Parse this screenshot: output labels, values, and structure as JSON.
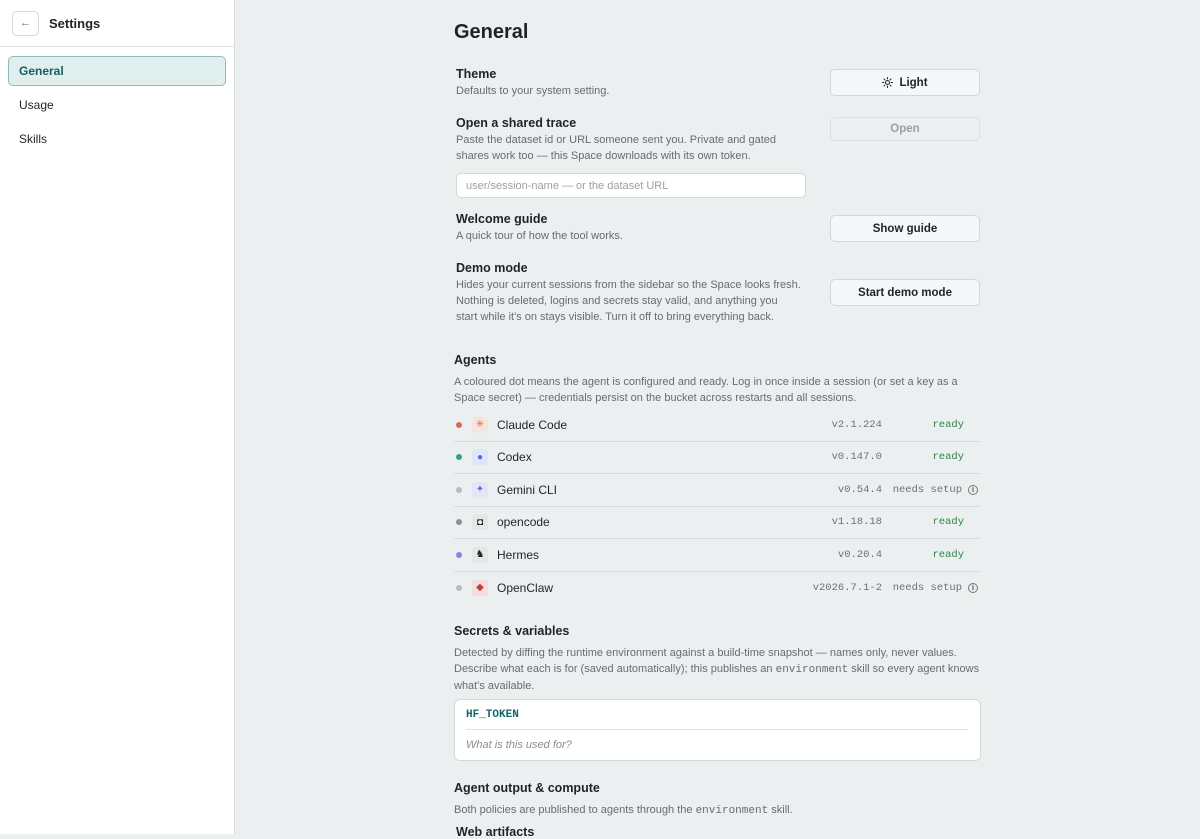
{
  "sidebar": {
    "back_glyph": "←",
    "title": "Settings",
    "items": [
      {
        "label": "General",
        "active": true
      },
      {
        "label": "Usage"
      },
      {
        "label": "Skills"
      }
    ]
  },
  "main": {
    "title": "General",
    "theme": {
      "title": "Theme",
      "desc": "Defaults to your system setting.",
      "button": "Light",
      "icon": "sun-icon"
    },
    "shared_trace": {
      "title": "Open a shared trace",
      "desc": "Paste the dataset id or URL someone sent you. Private and gated shares work too — this Space downloads with its own token.",
      "button": "Open",
      "placeholder": "user/session-name — or the dataset URL"
    },
    "welcome": {
      "title": "Welcome guide",
      "desc": "A quick tour of how the tool works.",
      "button": "Show guide"
    },
    "demo": {
      "title": "Demo mode",
      "desc": "Hides your current sessions from the sidebar so the Space looks fresh. Nothing is deleted, logins and secrets stay valid, and anything you start while it's on stays visible. Turn it off to bring everything back.",
      "button": "Start demo mode"
    },
    "agents": {
      "title": "Agents",
      "desc": "A coloured dot means the agent is configured and ready. Log in once inside a session (or set a key as a Space secret) — credentials persist on the bucket across restarts and all sessions.",
      "list": [
        {
          "name": "Claude Code",
          "version": "v2.1.224",
          "status": "ready",
          "dot": "#d9694a",
          "icon_bg": "#f7e4dc",
          "icon_color": "#d9694a",
          "glyph": "✳"
        },
        {
          "name": "Codex",
          "version": "v0.147.0",
          "status": "ready",
          "dot": "#3a9e8f",
          "icon_bg": "#dfe6fb",
          "icon_color": "#4d6fe0",
          "glyph": "●"
        },
        {
          "name": "Gemini CLI",
          "version": "v0.54.4",
          "status": "needs setup",
          "dot": "#b7bbbf",
          "icon_bg": "#e3e6f7",
          "icon_color": "#6a6fd6",
          "glyph": "✦"
        },
        {
          "name": "opencode",
          "version": "v1.18.18",
          "status": "ready",
          "dot": "#8a8f94",
          "icon_bg": "#e4e6e8",
          "icon_color": "#111111",
          "glyph": "◘"
        },
        {
          "name": "Hermes",
          "version": "v0.20.4",
          "status": "ready",
          "dot": "#9a7be0",
          "icon_bg": "#e5e6e8",
          "icon_color": "#222222",
          "glyph": "♞"
        },
        {
          "name": "OpenClaw",
          "version": "v2026.7.1-2",
          "status": "needs setup",
          "dot": "#b7bbbf",
          "icon_bg": "#f5dede",
          "icon_color": "#c93a3a",
          "glyph": "◆"
        }
      ]
    },
    "secrets": {
      "title": "Secrets & variables",
      "desc_pre": "Detected by diffing the runtime environment against a build-time snapshot — names only, never values. Describe what each is for (saved automatically); this publishes an ",
      "desc_code": "environment",
      "desc_post": " skill so every agent knows what's available.",
      "name": "HF_TOKEN",
      "placeholder": "What is this used for?"
    },
    "compute": {
      "title": "Agent output & compute",
      "desc_pre": "Both policies are published to agents through the ",
      "desc_code": "environment",
      "desc_post": " skill.",
      "next_title": "Web artifacts"
    }
  }
}
